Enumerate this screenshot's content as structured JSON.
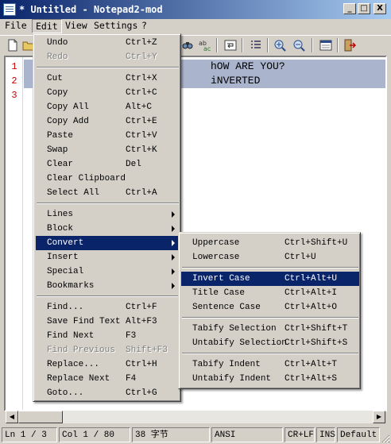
{
  "window": {
    "title": "* Untitled - Notepad2-mod",
    "buttons": [
      "_",
      "□",
      "X"
    ]
  },
  "menubar": [
    "File",
    "Edit",
    "View",
    "Settings",
    "?"
  ],
  "editor": {
    "line_numbers": [
      "1",
      "2",
      "3"
    ],
    "lines": [
      "hOW ARE YOU?",
      "iNVERTED",
      ""
    ]
  },
  "edit_menu": {
    "items": [
      {
        "label": "Undo",
        "shortcut": "Ctrl+Z",
        "disabled": false
      },
      {
        "label": "Redo",
        "shortcut": "Ctrl+Y",
        "disabled": true
      },
      {
        "label": "Cut",
        "shortcut": "Ctrl+X",
        "disabled": false
      },
      {
        "label": "Copy",
        "shortcut": "Ctrl+C",
        "disabled": false
      },
      {
        "label": "Copy All",
        "shortcut": "Alt+C",
        "disabled": false
      },
      {
        "label": "Copy Add",
        "shortcut": "Ctrl+E",
        "disabled": false
      },
      {
        "label": "Paste",
        "shortcut": "Ctrl+V",
        "disabled": false
      },
      {
        "label": "Swap",
        "shortcut": "Ctrl+K",
        "disabled": false
      },
      {
        "label": "Clear",
        "shortcut": "Del",
        "disabled": false
      },
      {
        "label": "Clear Clipboard",
        "shortcut": "",
        "disabled": false
      },
      {
        "label": "Select All",
        "shortcut": "Ctrl+A",
        "disabled": false
      },
      {
        "label": "Lines",
        "shortcut": "",
        "disabled": false
      },
      {
        "label": "Block",
        "shortcut": "",
        "disabled": false
      },
      {
        "label": "Convert",
        "shortcut": "",
        "disabled": false
      },
      {
        "label": "Insert",
        "shortcut": "",
        "disabled": false
      },
      {
        "label": "Special",
        "shortcut": "",
        "disabled": false
      },
      {
        "label": "Bookmarks",
        "shortcut": "",
        "disabled": false
      },
      {
        "label": "Find...",
        "shortcut": "Ctrl+F",
        "disabled": false
      },
      {
        "label": "Save Find Text",
        "shortcut": "Alt+F3",
        "disabled": false
      },
      {
        "label": "Find Next",
        "shortcut": "F3",
        "disabled": false
      },
      {
        "label": "Find Previous",
        "shortcut": "Shift+F3",
        "disabled": true
      },
      {
        "label": "Replace...",
        "shortcut": "Ctrl+H",
        "disabled": false
      },
      {
        "label": "Replace Next",
        "shortcut": "F4",
        "disabled": false
      },
      {
        "label": "Goto...",
        "shortcut": "Ctrl+G",
        "disabled": false
      }
    ]
  },
  "convert_menu": {
    "items": [
      {
        "label": "Uppercase",
        "shortcut": "Ctrl+Shift+U"
      },
      {
        "label": "Lowercase",
        "shortcut": "Ctrl+U"
      },
      {
        "label": "Invert Case",
        "shortcut": "Ctrl+Alt+U"
      },
      {
        "label": "Title Case",
        "shortcut": "Ctrl+Alt+I"
      },
      {
        "label": "Sentence Case",
        "shortcut": "Ctrl+Alt+O"
      },
      {
        "label": "Tabify Selection",
        "shortcut": "Ctrl+Shift+T"
      },
      {
        "label": "Untabify Selection",
        "shortcut": "Ctrl+Shift+S"
      },
      {
        "label": "Tabify Indent",
        "shortcut": "Ctrl+Alt+T"
      },
      {
        "label": "Untabify Indent",
        "shortcut": "Ctrl+Alt+S"
      }
    ]
  },
  "statusbar": {
    "position": "Ln 1 / 3",
    "column": "Col 1 / 80",
    "size": "38 字节",
    "encoding": "ANSI",
    "line_endings": "CR+LF",
    "mode": "INS",
    "scheme": "Default"
  },
  "colors": {
    "titlebar": "#0a246a",
    "menu_highlight": "#0a246a",
    "line_numbers": "#cc0000",
    "selection": "#aab4cc"
  },
  "icons": [
    "notepad-app-icon",
    "new-file-icon",
    "open-file-icon",
    "find-icon",
    "spellcheck-icon",
    "word-wrap-icon",
    "line-numbers-icon",
    "zoom-in-icon",
    "zoom-out-icon",
    "settings-icon",
    "exit-icon"
  ]
}
